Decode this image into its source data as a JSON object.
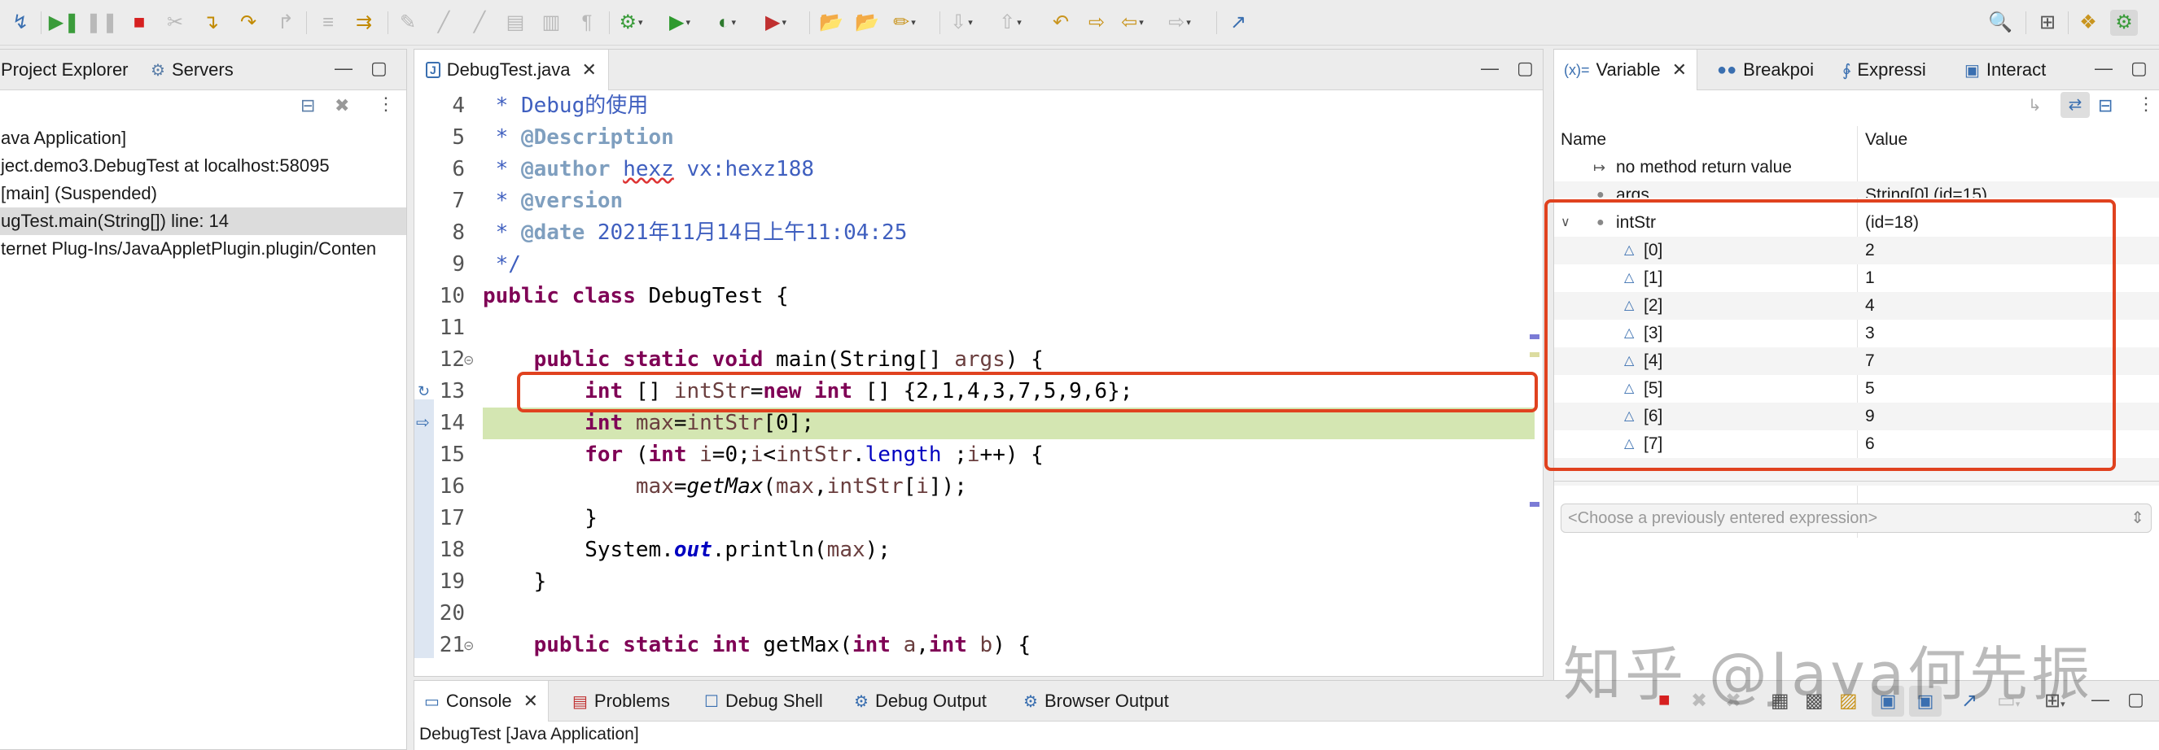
{
  "toolbar": {
    "icons": [
      "debug-skip-icon",
      "resume-icon",
      "suspend-icon",
      "terminate-icon",
      "disconnect-icon",
      "step-into-icon",
      "step-over-icon",
      "step-return-icon",
      "drop-to-frame-icon",
      "use-step-filters-icon",
      "toggle-breakpoint-icon",
      "debug-icon",
      "run-icon",
      "coverage-icon",
      "external-tools-icon",
      "new-package-icon",
      "open-type-icon",
      "search-icon",
      "back-icon",
      "forward-icon",
      "pin-editor-icon"
    ]
  },
  "debug_view": {
    "tabs": [
      {
        "label": "Project Explorer",
        "icon": "folder-icon"
      },
      {
        "label": "Servers",
        "icon": "servers-icon"
      }
    ],
    "items": [
      "ava Application]",
      "ject.demo3.DebugTest at localhost:58095",
      " [main] (Suspended)",
      "ugTest.main(String[]) line: 14",
      "ternet Plug-Ins/JavaAppletPlugin.plugin/Conten"
    ],
    "selected_index": 3
  },
  "editor": {
    "tab_label": "DebugTest.java",
    "lines": [
      {
        "num": "4",
        "text": " * Debug的使用"
      },
      {
        "num": "5",
        "text": " * @Description"
      },
      {
        "num": "6",
        "text": " * @author hexz vx:hexz188"
      },
      {
        "num": "7",
        "text": " * @version"
      },
      {
        "num": "8",
        "text": " * @date 2021年11月14日上午11:04:25"
      },
      {
        "num": "9",
        "text": " */"
      },
      {
        "num": "10",
        "text": "public class DebugTest {"
      },
      {
        "num": "11",
        "text": ""
      },
      {
        "num": "12",
        "text": "    public static void main(String[] args) {"
      },
      {
        "num": "13",
        "text": "        int [] intStr=new int [] {2,1,4,3,7,5,9,6};"
      },
      {
        "num": "14",
        "text": "        int max=intStr[0];"
      },
      {
        "num": "15",
        "text": "        for (int i=0;i<intStr.length ;i++) {"
      },
      {
        "num": "16",
        "text": "            max=getMax(max,intStr[i]);"
      },
      {
        "num": "17",
        "text": "        }"
      },
      {
        "num": "18",
        "text": "        System.out.println(max);"
      },
      {
        "num": "19",
        "text": "    }"
      },
      {
        "num": "20",
        "text": ""
      },
      {
        "num": "21",
        "text": "    public static int getMax(int a,int b) {"
      }
    ],
    "current_line": "14"
  },
  "variables_view": {
    "tabs": [
      {
        "label": "Variable",
        "icon": "variables-icon",
        "prefix": "(x)="
      },
      {
        "label": "Breakpoi",
        "icon": "breakpoints-icon"
      },
      {
        "label": "Expressi",
        "icon": "expressions-icon"
      },
      {
        "label": "Interact",
        "icon": "interactive-console-icon"
      }
    ],
    "columns": [
      "Name",
      "Value"
    ],
    "rows": [
      {
        "name": "no method return value",
        "value": "",
        "indent": 1,
        "icon": "return-value-icon"
      },
      {
        "name": "args",
        "value": "String[0]  (id=15)",
        "indent": 1,
        "icon": "local-variable-icon"
      },
      {
        "name": "intStr",
        "value": "(id=18)",
        "indent": 1,
        "icon": "local-variable-icon",
        "expanded": true
      },
      {
        "name": "[0]",
        "value": "2",
        "indent": 2,
        "icon": "array-element-icon"
      },
      {
        "name": "[1]",
        "value": "1",
        "indent": 2,
        "icon": "array-element-icon"
      },
      {
        "name": "[2]",
        "value": "4",
        "indent": 2,
        "icon": "array-element-icon"
      },
      {
        "name": "[3]",
        "value": "3",
        "indent": 2,
        "icon": "array-element-icon"
      },
      {
        "name": "[4]",
        "value": "7",
        "indent": 2,
        "icon": "array-element-icon"
      },
      {
        "name": "[5]",
        "value": "5",
        "indent": 2,
        "icon": "array-element-icon"
      },
      {
        "name": "[6]",
        "value": "9",
        "indent": 2,
        "icon": "array-element-icon"
      },
      {
        "name": "[7]",
        "value": "6",
        "indent": 2,
        "icon": "array-element-icon"
      }
    ],
    "expression_placeholder": "<Choose a previously entered expression>"
  },
  "console_view": {
    "tabs": [
      {
        "label": "Console",
        "icon": "console-icon"
      },
      {
        "label": "Problems",
        "icon": "problems-icon"
      },
      {
        "label": "Debug Shell",
        "icon": "debug-shell-icon"
      },
      {
        "label": "Debug Output",
        "icon": "debug-output-icon"
      },
      {
        "label": "Browser Output",
        "icon": "browser-output-icon"
      }
    ],
    "status": "DebugTest [Java Application]"
  },
  "watermark": "知乎 @Java何先振",
  "colors": {
    "highlight_box": "#e0421f",
    "current_line": "#d4e6b2",
    "keyword": "#7f0055",
    "javadoc": "#3f5fbf"
  }
}
